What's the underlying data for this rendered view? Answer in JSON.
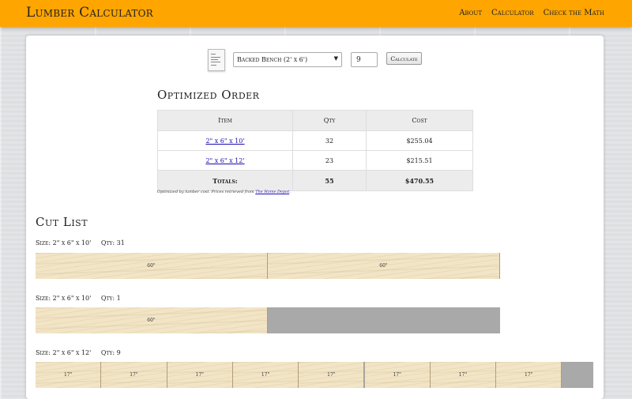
{
  "nav": {
    "brand": "Lumber Calculator",
    "links": [
      "About",
      "Calculator",
      "Check the Math"
    ]
  },
  "controls": {
    "project": "Backed Bench (2' x 6')",
    "quantity": "9",
    "calculate_label": "Calculate"
  },
  "order": {
    "title": "Optimized Order",
    "headers": [
      "Item",
      "Qty",
      "Cost"
    ],
    "rows": [
      {
        "item": "2\" x 6\" x 10'",
        "qty": "32",
        "cost": "$255.04"
      },
      {
        "item": "2\" x 6\" x 12'",
        "qty": "23",
        "cost": "$215.51"
      }
    ],
    "totals": {
      "label": "Totals:",
      "qty": "55",
      "cost": "$470.55"
    },
    "note_prefix": "Optimized by lumber cost. Prices retrieved from",
    "note_source": "The Home Depot",
    "note_suffix": "."
  },
  "cutlist": {
    "title": "Cut List",
    "size_prefix": "Size:",
    "qty_prefix": "Qty:",
    "boards": [
      {
        "size": "2\" x 6\" x 10'",
        "qty": "31",
        "length_in": 120,
        "cuts": [
          {
            "label": "60\"",
            "length_in": 60
          },
          {
            "label": "60\"",
            "length_in": 60
          }
        ]
      },
      {
        "size": "2\" x 6\" x 10'",
        "qty": "1",
        "length_in": 120,
        "cuts": [
          {
            "label": "60\"",
            "length_in": 60
          }
        ]
      },
      {
        "size": "2\" x 6\" x 12'",
        "qty": "9",
        "length_in": 144,
        "cuts": [
          {
            "label": "17\"",
            "length_in": 17
          },
          {
            "label": "17\"",
            "length_in": 17
          },
          {
            "label": "17\"",
            "length_in": 17
          },
          {
            "label": "17\"",
            "length_in": 17
          },
          {
            "label": "17\"",
            "length_in": 17
          },
          {
            "label": "17\"",
            "length_in": 17
          },
          {
            "label": "17\"",
            "length_in": 17
          },
          {
            "label": "17\"",
            "length_in": 17
          }
        ]
      }
    ]
  }
}
